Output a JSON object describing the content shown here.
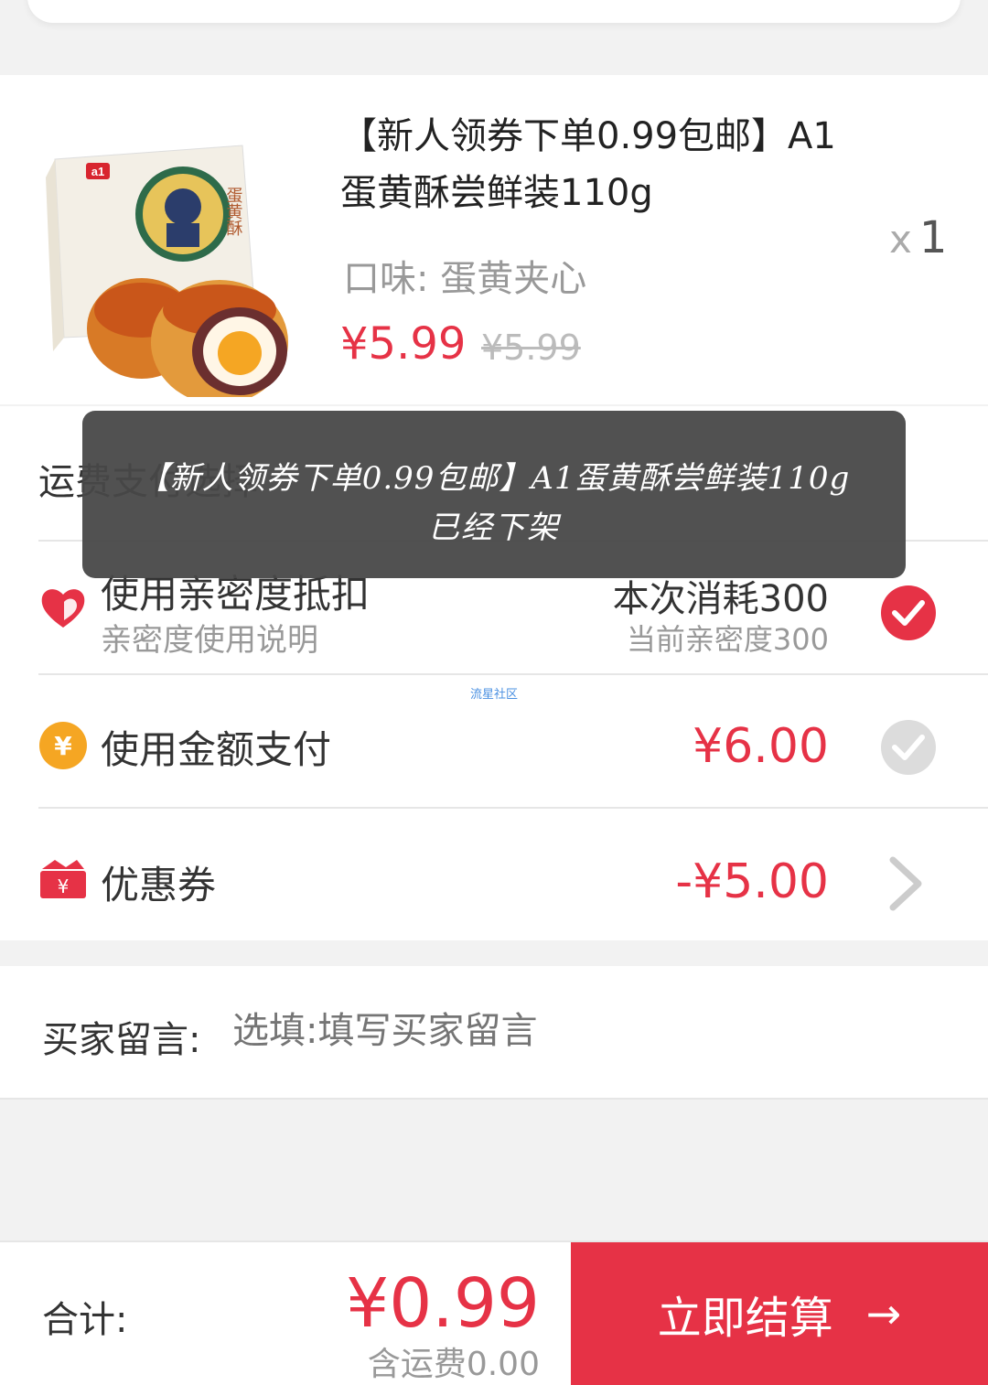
{
  "product": {
    "title": "【新人领券下单0.99包邮】A1蛋黄酥尝鲜装110g",
    "flavor": "口味: 蛋黄夹心",
    "price": "¥5.99",
    "original_price": "¥5.99",
    "qty_symbol": "x",
    "qty": "1",
    "image_brand": "a1",
    "image_label": "蛋黄酥"
  },
  "options": {
    "section_title": "运费支付选择",
    "intimacy": {
      "label": "使用亲密度抵扣",
      "sub": "亲密度使用说明",
      "consume": "本次消耗300",
      "current": "当前亲密度300",
      "checked": true
    },
    "balance": {
      "label": "使用金额支付",
      "amount": "¥6.00",
      "checked": false
    },
    "coupon": {
      "label": "优惠券",
      "amount": "-¥5.00"
    },
    "watermark": "流星社区"
  },
  "message": {
    "label": "买家留言:",
    "placeholder": "选填:填写买家留言"
  },
  "footer": {
    "total_label": "合计:",
    "total_price": "¥0.99",
    "shipping": "含运费0.00",
    "checkout_label": "立即结算",
    "arrow": "→"
  },
  "toast": {
    "line1": "【新人领券下单0.99包邮】A1蛋黄酥尝鲜装110g",
    "line2": "已经下架"
  },
  "colors": {
    "accent": "#e63246",
    "gold": "#f5a623",
    "muted": "#999999"
  }
}
